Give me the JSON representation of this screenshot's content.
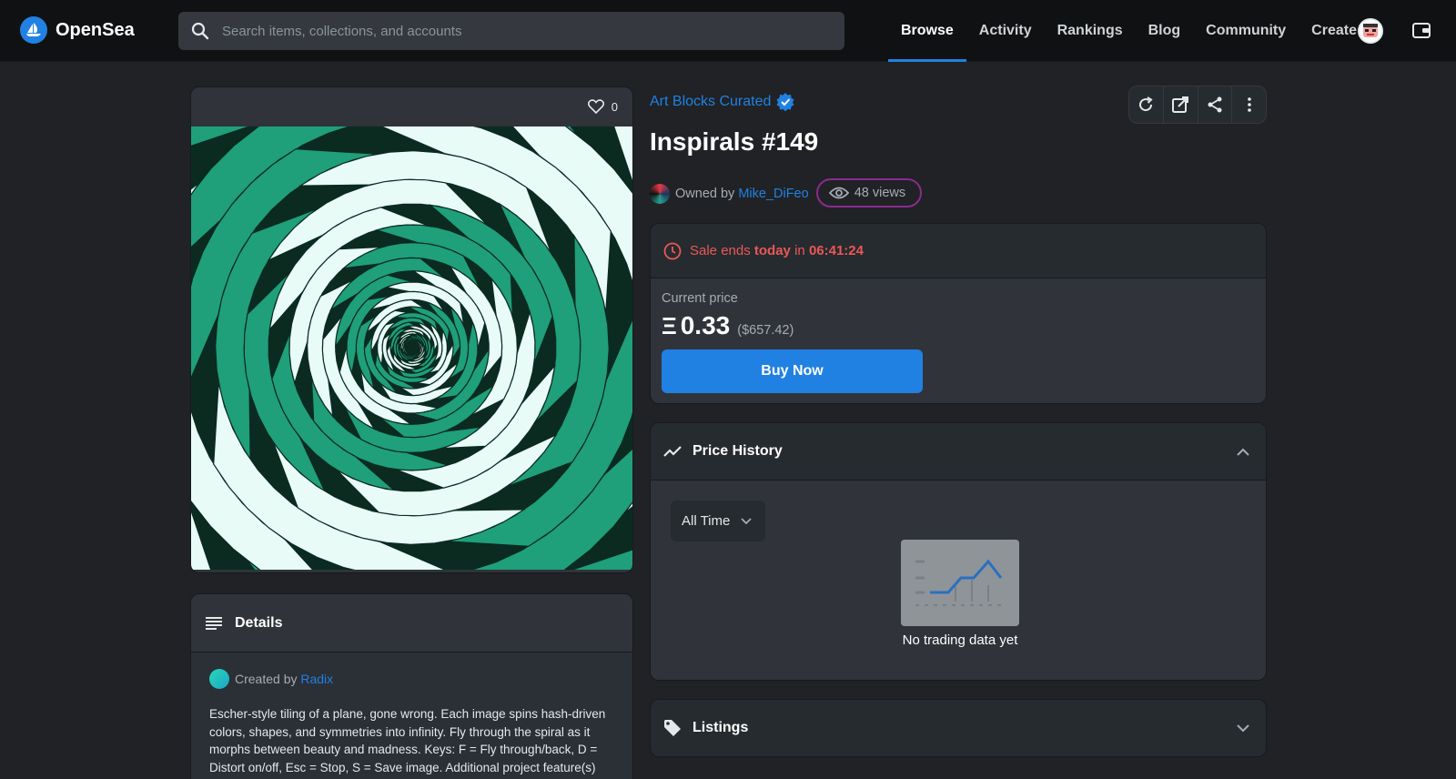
{
  "nav": {
    "brand": "OpenSea",
    "search_placeholder": "Search items, collections, and accounts",
    "links": [
      "Browse",
      "Activity",
      "Rankings",
      "Blog",
      "Community",
      "Create"
    ],
    "active_link": "Browse"
  },
  "media": {
    "favorites": "0",
    "icons": {
      "favorite": "heart-icon"
    }
  },
  "details": {
    "title": "Details",
    "created_prefix": "Created by",
    "creator": "Radix",
    "description": "Escher-style tiling of a plane, gone wrong. Each image spins hash-driven colors, shapes, and symmetries into infinity. Fly through the spiral as it morphs between beauty and madness. Keys: F = Fly through/back, D = Distort on/off, Esc = Stop, S = Save image. Additional project feature(s)"
  },
  "item": {
    "collection": "Art Blocks Curated",
    "title": "Inspirals #149",
    "owned_prefix": "Owned by",
    "owner": "Mike_DiFeo",
    "views": "48 views"
  },
  "sale": {
    "prefix": "Sale ends",
    "day": "today",
    "mid": "in",
    "time": "06:41:24",
    "price_label": "Current price",
    "eth_symbol": "Ξ",
    "price": "0.33",
    "usd": "($657.42)",
    "buy_label": "Buy Now"
  },
  "price_history": {
    "title": "Price History",
    "range": "All Time",
    "empty_text": "No trading data yet"
  },
  "listings": {
    "title": "Listings"
  },
  "colors": {
    "accent": "#2081e2",
    "sale_red": "#eb5757",
    "art_green": "#1f9f7a",
    "art_dark": "#0b2b21",
    "art_light": "#e8fbf6"
  }
}
